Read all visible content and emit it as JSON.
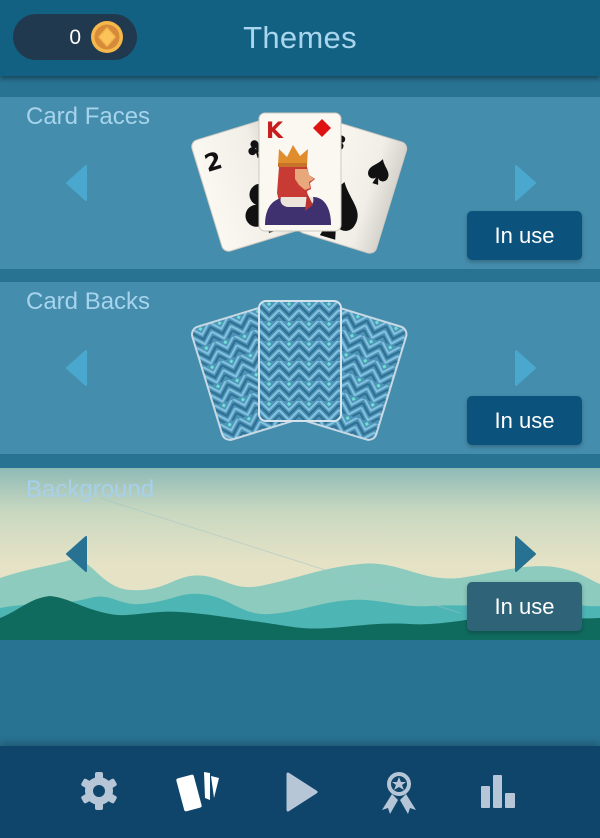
{
  "header": {
    "title": "Themes",
    "coins": "0",
    "coin_icon": "coin-icon"
  },
  "sections": [
    {
      "id": "card-faces",
      "title": "Card Faces",
      "button_label": "In use",
      "preview": {
        "left_card": {
          "rank": "2",
          "suit": "club"
        },
        "center_card": {
          "rank": "K",
          "suit": "diamond",
          "figure": "king"
        },
        "right_card": {
          "rank": "8",
          "suit": "spade"
        }
      }
    },
    {
      "id": "card-backs",
      "title": "Card Backs",
      "button_label": "In use",
      "preview": {
        "pattern": "blue-chevron-diamond"
      }
    },
    {
      "id": "background",
      "title": "Background",
      "button_label": "In use",
      "preview": {
        "scene": "teal-mountains"
      }
    }
  ],
  "navbar": {
    "items": [
      {
        "name": "settings",
        "icon": "gear-icon",
        "active": false
      },
      {
        "name": "themes",
        "icon": "cards-icon",
        "active": true
      },
      {
        "name": "play",
        "icon": "play-icon",
        "active": false
      },
      {
        "name": "achievements",
        "icon": "ribbon-award-icon",
        "active": false
      },
      {
        "name": "statistics",
        "icon": "bar-chart-icon",
        "active": false
      }
    ]
  },
  "colors": {
    "header_bg": "#136182",
    "section_bg": "#458dad",
    "button_bg": "#0b527d",
    "title_text": "#a9d6ee",
    "arrow": "#4aa8cf",
    "navbar_bg": "#0f456b",
    "nav_icon": "#b6c6d6",
    "coin": "#f2b34a"
  }
}
